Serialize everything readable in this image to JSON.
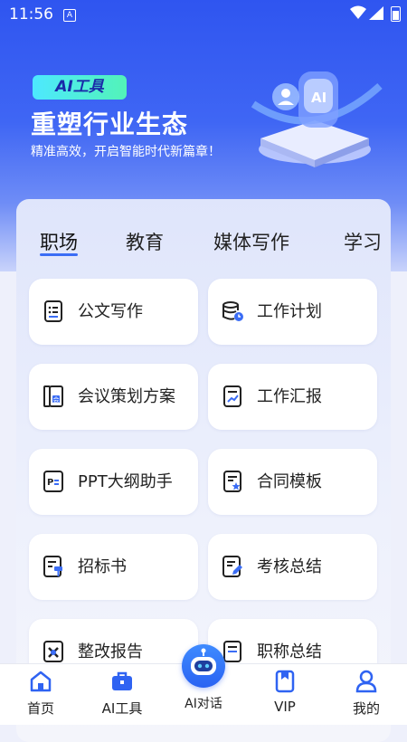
{
  "status_bar": {
    "time": "11:56",
    "notification_glyph": "A"
  },
  "hero": {
    "badge": "AI工具",
    "title": "重塑行业生态",
    "subtitle": "精准高效，开启智能时代新篇章！"
  },
  "tabs": [
    {
      "label": "职场",
      "active": true
    },
    {
      "label": "教育",
      "active": false
    },
    {
      "label": "媒体写作",
      "active": false
    },
    {
      "label": "学习",
      "active": false
    }
  ],
  "tools": [
    {
      "label": "公文写作",
      "icon": "document-list-icon"
    },
    {
      "label": "工作计划",
      "icon": "database-clock-icon"
    },
    {
      "label": "会议策划方案",
      "icon": "meeting-book-icon"
    },
    {
      "label": "工作汇报",
      "icon": "chart-report-icon"
    },
    {
      "label": "PPT大纲助手",
      "icon": "ppt-outline-icon"
    },
    {
      "label": "合同模板",
      "icon": "contract-star-icon"
    },
    {
      "label": "招标书",
      "icon": "bid-document-icon"
    },
    {
      "label": "考核总结",
      "icon": "edit-summary-icon"
    },
    {
      "label": "整改报告",
      "icon": "rectify-report-icon"
    },
    {
      "label": "职称总结",
      "icon": "title-summary-icon"
    }
  ],
  "bottom_nav": [
    {
      "label": "首页",
      "icon": "home-icon"
    },
    {
      "label": "AI工具",
      "icon": "toolbox-icon"
    },
    {
      "label": "AI对话",
      "icon": "robot-icon"
    },
    {
      "label": "VIP",
      "icon": "vip-bookmark-icon"
    },
    {
      "label": "我的",
      "icon": "user-icon"
    }
  ],
  "colors": {
    "accent": "#3b6df5",
    "hero_top": "#2f55f0",
    "badge": "#4de8ff"
  }
}
